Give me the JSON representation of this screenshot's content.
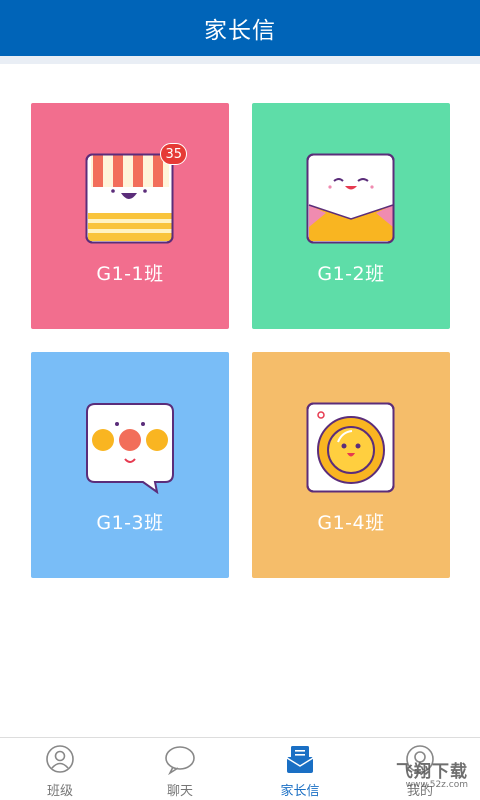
{
  "header": {
    "title": "家长信"
  },
  "cards": [
    {
      "label": "G1-1班",
      "badge": "35",
      "color": "#f26e8e"
    },
    {
      "label": "G1-2班",
      "color": "#5edda8"
    },
    {
      "label": "G1-3班",
      "color": "#79bdf7"
    },
    {
      "label": "G1-4班",
      "color": "#f5bd6a"
    }
  ],
  "tabbar": {
    "items": [
      {
        "label": "班级",
        "icon": "user-icon"
      },
      {
        "label": "聊天",
        "icon": "chat-bubble-icon"
      },
      {
        "label": "家长信",
        "icon": "letter-icon",
        "active": true
      },
      {
        "label": "我的",
        "icon": "profile-icon"
      }
    ],
    "active_color": "#1a6fc4"
  },
  "watermark": {
    "main": "飞翔下载",
    "sub": "www.52z.com"
  }
}
